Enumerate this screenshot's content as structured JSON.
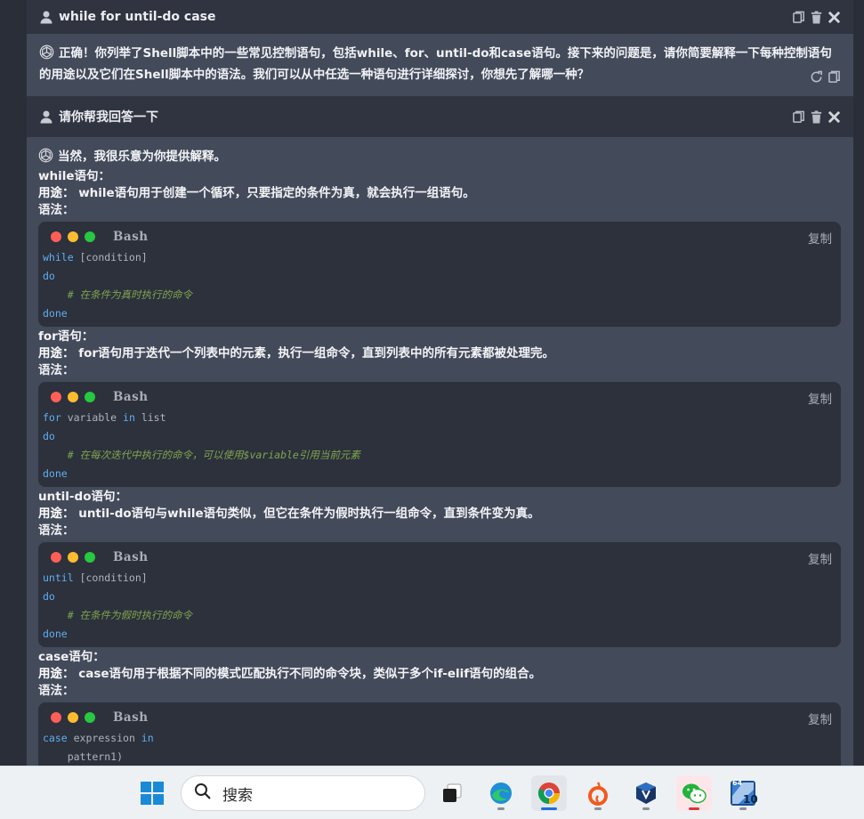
{
  "conversation": {
    "user_msg_1": "while for until-do case",
    "bot_msg_1": "正确！你列举了Shell脚本中的一些常见控制语句，包括while、for、until-do和case语句。接下来的问题是，请你简要解释一下每种控制语句的用途以及它们在Shell脚本中的语法。我们可以从中任选一种语句进行详细探讨，你想先了解哪一种？",
    "user_msg_2": "请你帮我回答一下",
    "bot_msg_2": {
      "intro": "当然，我很乐意为你提供解释。",
      "sections": [
        {
          "heading": "while语句：",
          "usage_label": "用途：",
          "usage": "while语句用于创建一个循环，只要指定的条件为真，就会执行一组语句。",
          "syntax_label": "语法：",
          "code_lang": "Bash",
          "copy_label": "复制",
          "code": [
            {
              "kw": "while",
              "rest": " [condition]"
            },
            {
              "kw": "do",
              "rest": ""
            },
            {
              "comment": "    # 在条件为真时执行的命令"
            },
            {
              "kw": "done",
              "rest": ""
            }
          ]
        },
        {
          "heading": "for语句：",
          "usage_label": "用途：",
          "usage": "for语句用于迭代一个列表中的元素，执行一组命令，直到列表中的所有元素都被处理完。",
          "syntax_label": "语法：",
          "code_lang": "Bash",
          "copy_label": "复制",
          "code": [
            {
              "kw": "for",
              "rest": " variable ",
              "kw2": "in",
              "rest2": " list"
            },
            {
              "kw": "do",
              "rest": ""
            },
            {
              "comment": "    # 在每次迭代中执行的命令，可以使用$variable引用当前元素"
            },
            {
              "kw": "done",
              "rest": ""
            }
          ]
        },
        {
          "heading": "until-do语句：",
          "usage_label": "用途：",
          "usage": "until-do语句与while语句类似，但它在条件为假时执行一组命令，直到条件变为真。",
          "syntax_label": "语法：",
          "code_lang": "Bash",
          "copy_label": "复制",
          "code": [
            {
              "kw": "until",
              "rest": " [condition]"
            },
            {
              "kw": "do",
              "rest": ""
            },
            {
              "comment": "    # 在条件为假时执行的命令"
            },
            {
              "kw": "done",
              "rest": ""
            }
          ]
        },
        {
          "heading": "case语句：",
          "usage_label": "用途：",
          "usage": "case语句用于根据不同的模式匹配执行不同的命令块，类似于多个if-elif语句的组合。",
          "syntax_label": "语法：",
          "code_lang": "Bash",
          "copy_label": "复制",
          "code": [
            {
              "kw": "case",
              "rest": " expression ",
              "kw2": "in",
              "rest2": ""
            },
            {
              "plain": "    pattern1)"
            }
          ]
        }
      ]
    }
  },
  "taskbar": {
    "search_placeholder": "搜索",
    "apps": [
      "start-button",
      "task-view",
      "edge",
      "chrome",
      "origin",
      "virtualbox",
      "wechat",
      "desktop-app-64-10"
    ],
    "app_badge_64": "64",
    "app_badge_10": "10"
  },
  "colors": {
    "user_bg": "#2f3440",
    "bot_bg": "#434a5a",
    "code_bg": "#2c313c",
    "keyword": "#61aeee",
    "comment": "#7fa64e",
    "taskbar_bg": "#eef1f4"
  }
}
